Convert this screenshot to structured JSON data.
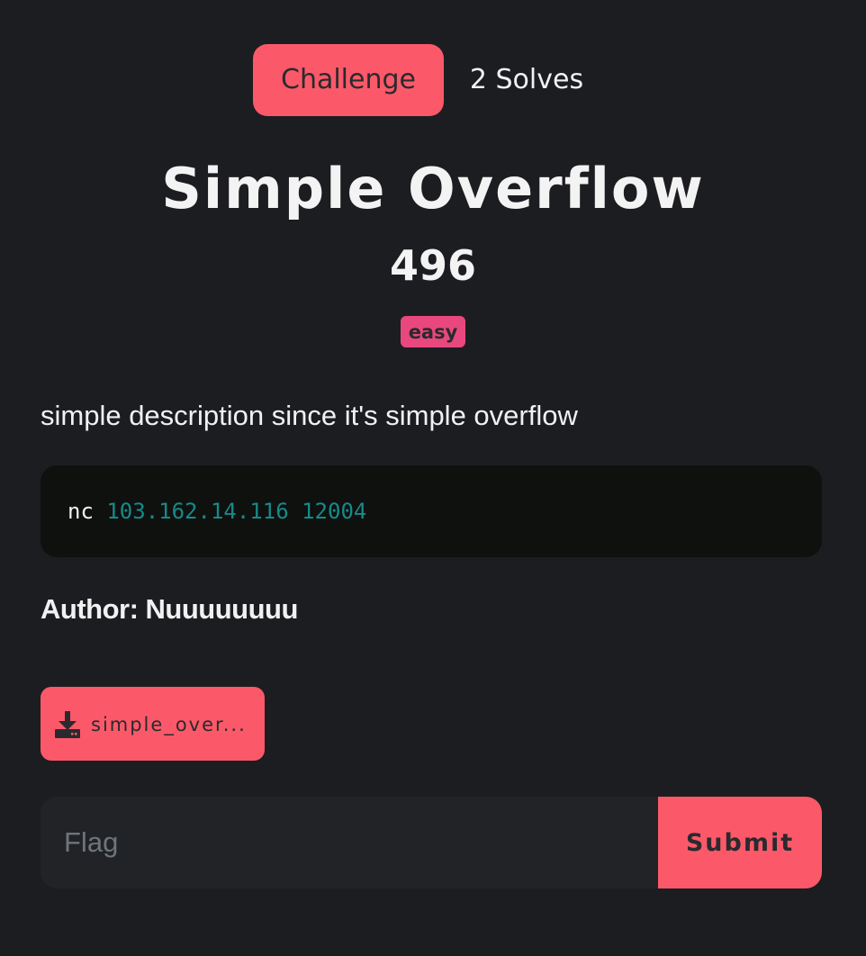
{
  "colors": {
    "accent": "#fb5969",
    "badge": "#e8487d",
    "background": "#1c1d21",
    "code_bg": "#0f110f",
    "code_arg": "#178a89"
  },
  "tabs": {
    "challenge_label": "Challenge",
    "solves_label": "2 Solves"
  },
  "challenge": {
    "name": "Simple Overflow",
    "points": "496",
    "difficulty": "easy",
    "description": "simple description since it's simple overflow",
    "code": {
      "command": "nc",
      "args": "103.162.14.116 12004"
    },
    "author": "Author: Nuuuuuuuu"
  },
  "download": {
    "icon": "download-icon",
    "label": "simple_over..."
  },
  "flag_form": {
    "placeholder": "Flag",
    "value": "",
    "submit_label": "Submit"
  }
}
